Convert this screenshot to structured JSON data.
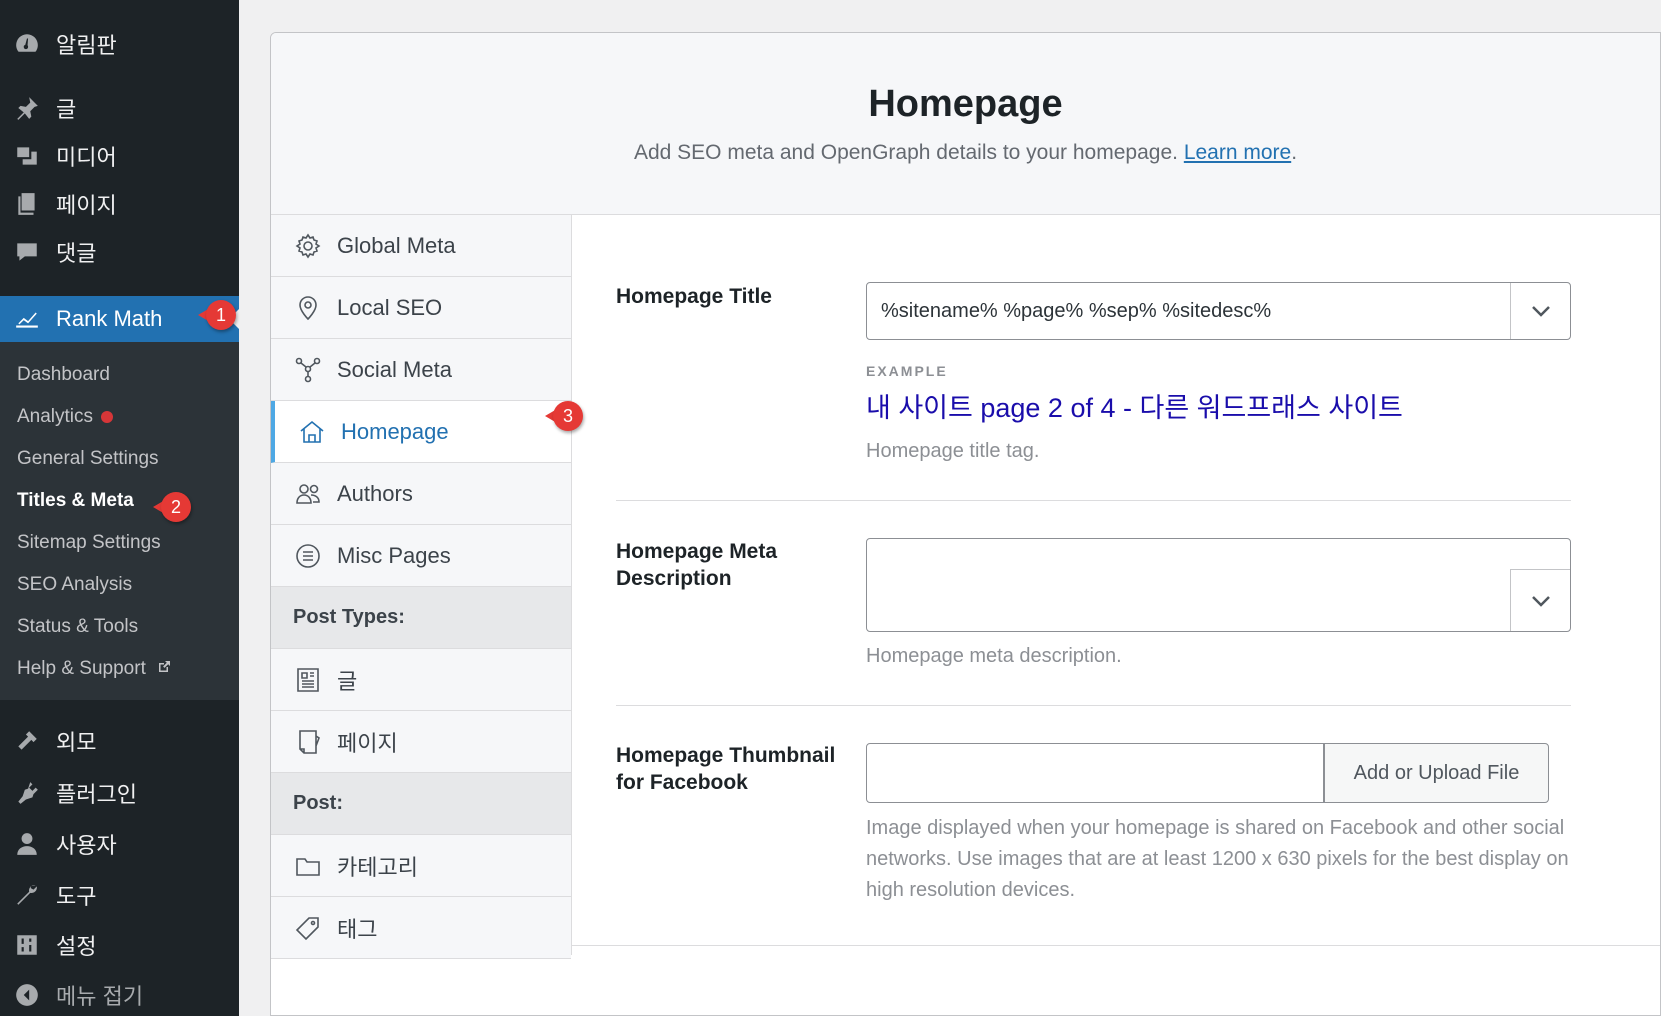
{
  "sidebar": {
    "top_items": [
      {
        "label": "알림판",
        "icon": "dashboard-icon"
      },
      {
        "label": "글",
        "icon": "pin-icon"
      },
      {
        "label": "미디어",
        "icon": "media-icon"
      },
      {
        "label": "페이지",
        "icon": "page-icon"
      },
      {
        "label": "댓글",
        "icon": "comment-icon"
      },
      {
        "label": "Rank Math",
        "icon": "rank-math-icon"
      }
    ],
    "submenu": [
      {
        "label": "Dashboard"
      },
      {
        "label": "Analytics"
      },
      {
        "label": "General Settings"
      },
      {
        "label": "Titles & Meta"
      },
      {
        "label": "Sitemap Settings"
      },
      {
        "label": "SEO Analysis"
      },
      {
        "label": "Status & Tools"
      },
      {
        "label": "Help & Support"
      }
    ],
    "bottom_items": [
      {
        "label": "외모",
        "icon": "appearance-icon"
      },
      {
        "label": "플러그인",
        "icon": "plugin-icon"
      },
      {
        "label": "사용자",
        "icon": "user-icon"
      },
      {
        "label": "도구",
        "icon": "tools-icon"
      },
      {
        "label": "설정",
        "icon": "settings-icon"
      },
      {
        "label": "메뉴 접기",
        "icon": "collapse-icon"
      }
    ]
  },
  "markers": [
    "1",
    "2",
    "3"
  ],
  "header": {
    "title": "Homepage",
    "description": "Add SEO meta and OpenGraph details to your homepage.",
    "learn_more": "Learn more",
    "period": "."
  },
  "tabs": [
    {
      "label": "Global Meta",
      "icon": "gear-icon"
    },
    {
      "label": "Local SEO",
      "icon": "location-pin-icon"
    },
    {
      "label": "Social Meta",
      "icon": "share-nodes-icon"
    },
    {
      "label": "Homepage",
      "icon": "home-icon"
    },
    {
      "label": "Authors",
      "icon": "users-icon"
    },
    {
      "label": "Misc Pages",
      "icon": "list-circle-icon"
    },
    {
      "label": "Post Types:"
    },
    {
      "label": "글",
      "icon": "post-icon"
    },
    {
      "label": "페이지",
      "icon": "page-tab-icon"
    },
    {
      "label": "Post:"
    },
    {
      "label": "카테고리",
      "icon": "folder-icon"
    },
    {
      "label": "태그",
      "icon": "tag-icon"
    }
  ],
  "fields": {
    "title": {
      "label": "Homepage Title",
      "value": "%sitename% %page% %sep% %sitedesc%",
      "example_label": "EXAMPLE",
      "example_text": "내 사이트 page 2 of 4 - 다른 워드프래스 사이트",
      "help": "Homepage title tag."
    },
    "meta_description": {
      "label": "Homepage Meta Description",
      "value": "",
      "help": "Homepage meta description."
    },
    "thumbnail": {
      "label": "Homepage Thumbnail for Facebook",
      "value": "",
      "button": "Add or Upload File",
      "help": "Image displayed when your homepage is shared on Facebook and other social networks. Use images that are at least 1200 x 630 pixels for the best display on high resolution devices."
    }
  },
  "colors": {
    "sidebar_bg": "#1d2327",
    "accent": "#2271b1",
    "example_link": "#1a0dab",
    "marker": "#e53935"
  }
}
